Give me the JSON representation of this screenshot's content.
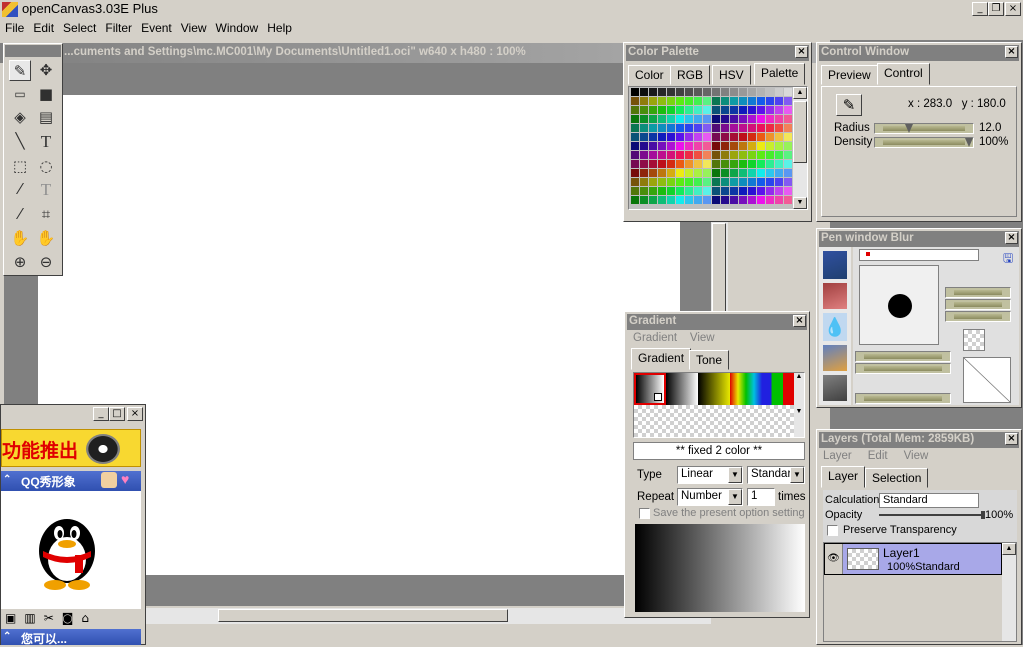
{
  "app": {
    "title": "openCanvas3.03E Plus"
  },
  "menu": [
    "File",
    "Edit",
    "Select",
    "Filter",
    "Event",
    "View",
    "Window",
    "Help"
  ],
  "document": {
    "title": "...cuments and Settings\\mc.MC001\\My Documents\\Untitled1.oci\" w640 x h480 : 100%"
  },
  "color_palette": {
    "title": "Color Palette",
    "tabs": [
      "Color",
      "RGB",
      "HSV",
      "Palette"
    ],
    "active_tab": "Palette"
  },
  "control_window": {
    "title": "Control Window",
    "tabs": [
      "Preview",
      "Control"
    ],
    "active_tab": "Control",
    "coords": "x : 283.0   y : 180.0",
    "radius_label": "Radius",
    "radius_value": "12.0",
    "radius_fraction": 0.33,
    "density_label": "Density",
    "density_value": "100%",
    "density_fraction": 1.0
  },
  "pen_window": {
    "title": "Pen window  Blur"
  },
  "gradient": {
    "title": "Gradient",
    "menu": [
      "Gradient",
      "View"
    ],
    "tabs": [
      "Gradient",
      "Tone"
    ],
    "active_tab": "Gradient",
    "preset_label": "** fixed 2 color **",
    "type_label": "Type",
    "type_value": "Linear",
    "mode_value": "Standar",
    "repeat_label": "Repeat",
    "repeat_value": "Number",
    "repeat_count": "1",
    "times_label": "times",
    "save_option_label": "Save the present option setting"
  },
  "layers": {
    "title": "Layers (Total Mem: 2859KB)",
    "menu": [
      "Layer",
      "Edit",
      "View"
    ],
    "tabs": [
      "Layer",
      "Selection"
    ],
    "active_tab": "Layer",
    "calculation_label": "Calculation",
    "calculation_value": "Standard",
    "opacity_label": "Opacity",
    "opacity_value": "100%",
    "preserve_label": "Preserve Transparency",
    "items": [
      {
        "name": "Layer1",
        "info": "100%Standard"
      }
    ]
  },
  "qq_window": {
    "banner": "功能推出",
    "section_title": "QQ秀形象",
    "footer": "您可以..."
  },
  "colors": {
    "title_inactive": "#808080",
    "layer_selected": "#a8a8e8",
    "face": "#d4d0c8"
  }
}
